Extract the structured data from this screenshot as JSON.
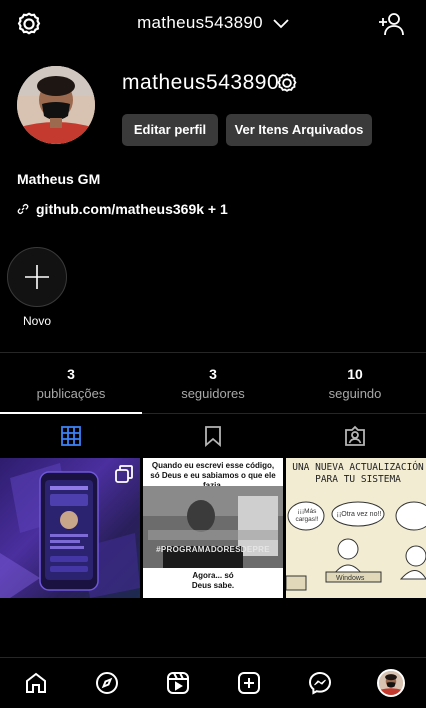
{
  "topbar": {
    "username": "matheus543890",
    "settings_icon": "settings-icon",
    "dropdown_icon": "chevron-down-icon",
    "add_user_icon": "add-user-icon"
  },
  "profile": {
    "username": "matheus543890",
    "edit_button": "Editar perfil",
    "archive_button": "Ver Itens Arquivados",
    "full_name": "Matheus GM",
    "link": "github.com/matheus369k + 1"
  },
  "highlights": {
    "new_label": "Novo"
  },
  "stats": [
    {
      "value": "3",
      "label": "publicações"
    },
    {
      "value": "3",
      "label": "seguidores"
    },
    {
      "value": "10",
      "label": "seguindo"
    }
  ],
  "posts": [
    {
      "kind": "image",
      "multiple": true
    },
    {
      "kind": "meme",
      "caption_top": "Quando eu escrevi esse código, só Deus e eu sabiamos o que ele fazia.",
      "watermark": "#PROGRAMADORESDEPRE",
      "caption_bottom": "Agora... só Deus sabe."
    },
    {
      "kind": "comic",
      "title": "UNA NUEVA ACTUALIZACIÓN PARA TU SISTEMA",
      "bubble1": "¡¡¡Más cargas!!",
      "bubble2": "¡¡Otra vez no!!",
      "caption": "Windows"
    }
  ],
  "bottom_nav": [
    "home-icon",
    "explore-icon",
    "reels-icon",
    "create-icon",
    "messenger-icon",
    "profile-avatar"
  ],
  "colors": {
    "background": "#000000",
    "button": "#3a3a3a",
    "divider": "#262626",
    "secondary_text": "#a8a8a8"
  }
}
